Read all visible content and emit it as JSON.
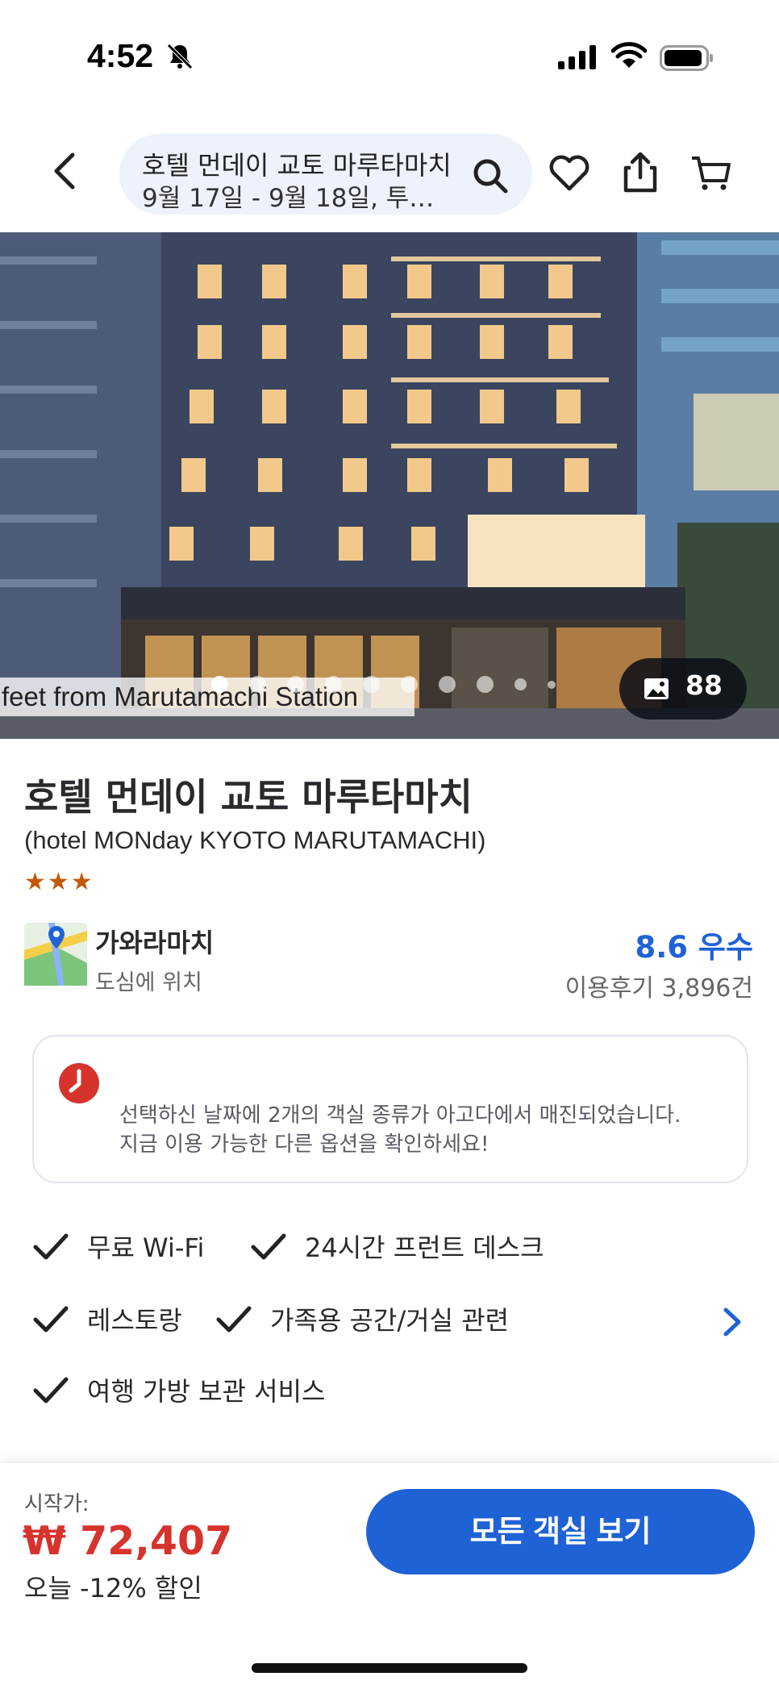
{
  "status_bar": {
    "time": "4:52"
  },
  "header": {
    "search_title": "호텔 먼데이 교토 마루타마치",
    "search_dates": "9월 17일 - 9월 18일, 투…"
  },
  "hero": {
    "caption": "feet from Marutamachi Station",
    "photo_count": "88",
    "carousel_pages": 10,
    "active_page": 0
  },
  "hotel": {
    "name": "호텔 먼데이 교토 마루타마치",
    "name_en": "(hotel MONday KYOTO MARUTAMACHI)",
    "stars": "★★★",
    "star_rating": 3
  },
  "location": {
    "name": "가와라마치",
    "description": "도심에 위치"
  },
  "rating": {
    "score_label": "8.6 우수",
    "reviews": "이용후기 3,896건"
  },
  "alert": {
    "line1": "선택하신 날짜에 2개의 객실 종류가 아고다에서 매진되었습니다.",
    "line2": "지금 이용 가능한 다른 옵션을 확인하세요!"
  },
  "amenities": [
    "무료 Wi-Fi",
    "24시간 프런트 데스크",
    "레스토랑",
    "가족용 공간/거실 관련",
    "여행 가방 보관 서비스"
  ],
  "booking": {
    "from_label": "시작가:",
    "price": "₩ 72,407",
    "discount": "오늘 -12% 할인",
    "cta": "모든 객실 보기"
  },
  "colors": {
    "accent": "#1f62d6",
    "price": "#d7332d",
    "stars": "#c15a08",
    "pill_bg": "#edf2fb"
  }
}
